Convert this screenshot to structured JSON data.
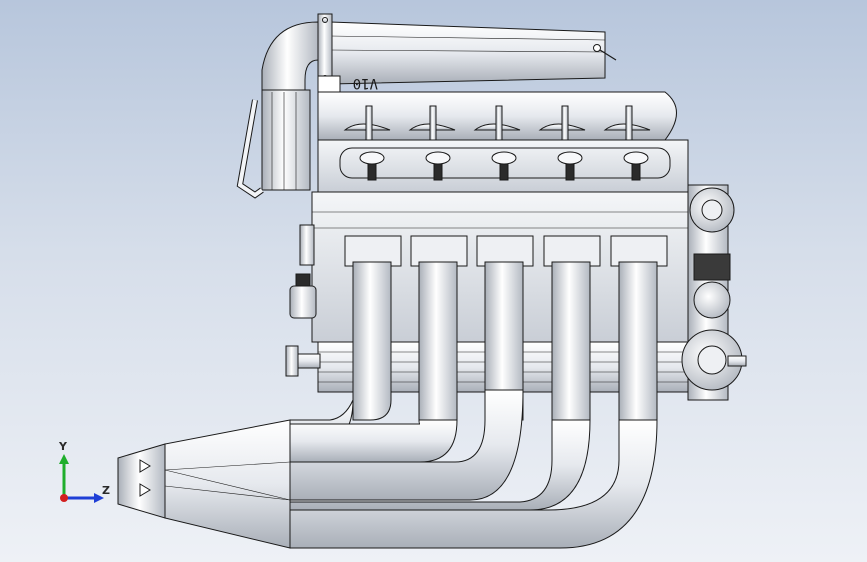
{
  "model": {
    "cover_text": "V10"
  },
  "triad": {
    "y_label": "Y",
    "z_label": "Z"
  },
  "colors": {
    "background_top": "#b7c6dc",
    "background_bottom": "#eef1f6",
    "metal_light": "#ffffff",
    "metal_mid": "#d9dde3",
    "metal_dark": "#9ea4ad",
    "edge": "#1a1a1a",
    "axis_y": "#1fae2c",
    "axis_z": "#1f3fd6",
    "axis_x": "#d21f1f"
  }
}
